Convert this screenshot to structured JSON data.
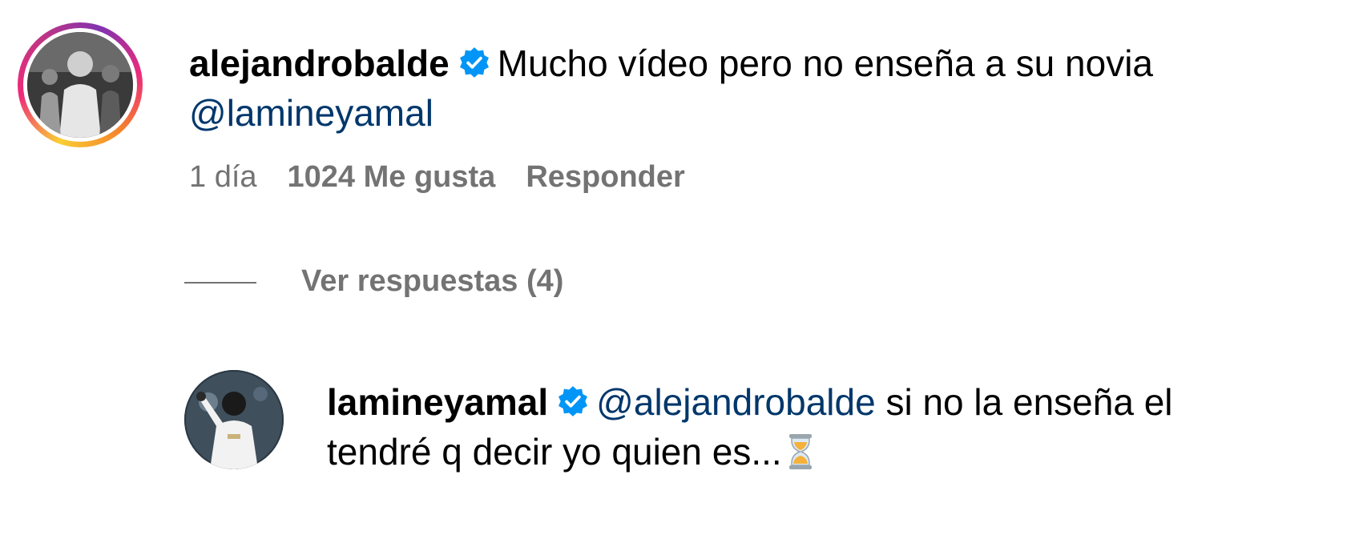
{
  "main_comment": {
    "username": "alejandrobalde",
    "verified": true,
    "text": "Mucho vídeo pero no enseña a su novia",
    "mention": "@lamineyamal",
    "timestamp": "1 día",
    "likes": "1024 Me gusta",
    "reply_label": "Responder"
  },
  "view_replies": {
    "label": "Ver respuestas (4)"
  },
  "reply": {
    "username": "lamineyamal",
    "verified": true,
    "mention": "@alejandrobalde",
    "text_line1": "si no la enseña el",
    "text_line2": "tendré q decir yo quien es...",
    "emoji": "hourglass"
  },
  "colors": {
    "mention": "#00376b",
    "meta": "#737373",
    "verified": "#0095f6"
  }
}
